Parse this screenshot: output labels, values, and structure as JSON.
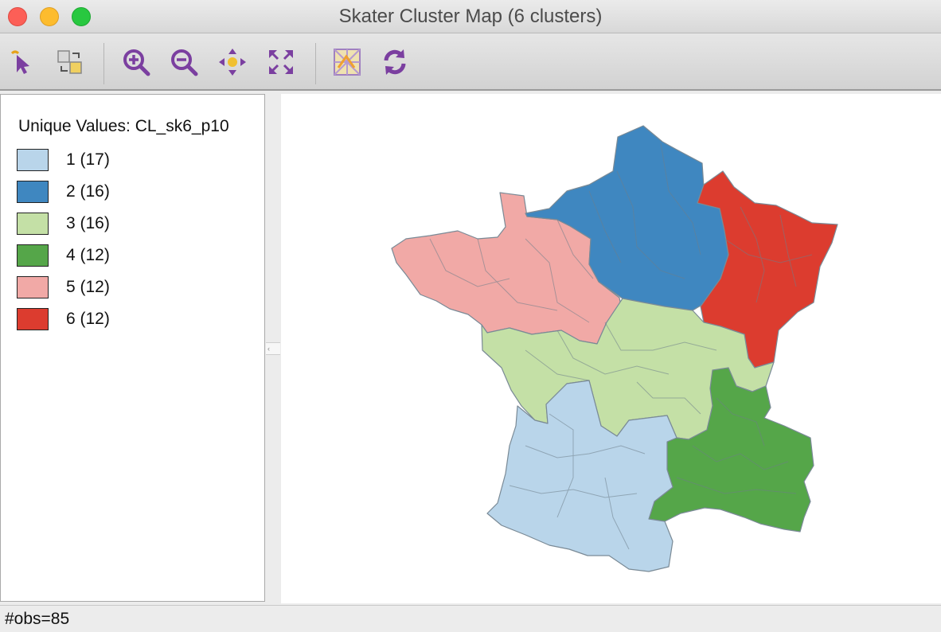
{
  "window": {
    "title": "Skater Cluster Map (6 clusters)"
  },
  "toolbar": {
    "buttons": [
      {
        "name": "select-tool",
        "icon": "pointer-icon"
      },
      {
        "name": "selection-mode",
        "icon": "select-shapes-icon"
      },
      {
        "name": "zoom-in",
        "icon": "zoom-in-icon"
      },
      {
        "name": "zoom-out",
        "icon": "zoom-out-icon"
      },
      {
        "name": "pan",
        "icon": "pan-icon"
      },
      {
        "name": "fit-extent",
        "icon": "full-extent-icon"
      },
      {
        "name": "basemap",
        "icon": "basemap-icon"
      },
      {
        "name": "refresh",
        "icon": "refresh-icon"
      }
    ]
  },
  "legend": {
    "title": "Unique Values: CL_sk6_p10",
    "items": [
      {
        "label": "1 (17)",
        "color": "#b9d5ea"
      },
      {
        "label": "2 (16)",
        "color": "#3f87c0"
      },
      {
        "label": "3 (16)",
        "color": "#c4e0a6"
      },
      {
        "label": "4 (12)",
        "color": "#55a649"
      },
      {
        "label": "5 (12)",
        "color": "#f1a9a6"
      },
      {
        "label": "6 (12)",
        "color": "#dc3c2f"
      }
    ]
  },
  "map": {
    "regions": [
      {
        "cluster": 1,
        "color": "#b9d5ea"
      },
      {
        "cluster": 2,
        "color": "#3f87c0"
      },
      {
        "cluster": 3,
        "color": "#c4e0a6"
      },
      {
        "cluster": 4,
        "color": "#55a649"
      },
      {
        "cluster": 5,
        "color": "#f1a9a6"
      },
      {
        "cluster": 6,
        "color": "#dc3c2f"
      }
    ]
  },
  "status": {
    "text": "#obs=85"
  }
}
